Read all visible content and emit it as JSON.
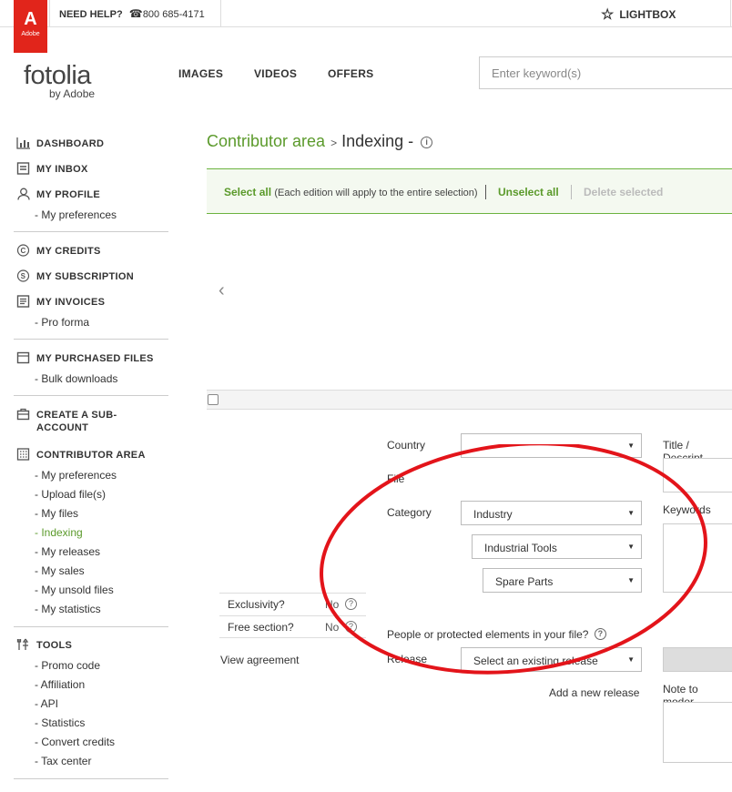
{
  "topbar": {
    "logo_text": "Adobe",
    "help_label": "NEED HELP?",
    "phone": "800 685-4171",
    "lightbox": "LIGHTBOX"
  },
  "header": {
    "brand": "fotolia",
    "brand_sub": "by Adobe",
    "nav": [
      "IMAGES",
      "VIDEOS",
      "OFFERS"
    ],
    "search_placeholder": "Enter keyword(s)"
  },
  "sidebar": {
    "dashboard": "DASHBOARD",
    "inbox": "MY INBOX",
    "profile": "MY PROFILE",
    "profile_sub": [
      "- My preferences"
    ],
    "credits": "MY CREDITS",
    "subscription": "MY SUBSCRIPTION",
    "invoices": "MY INVOICES",
    "invoices_sub": [
      "- Pro forma"
    ],
    "purchased": "MY PURCHASED FILES",
    "purchased_sub": [
      "- Bulk downloads"
    ],
    "subaccount_line1": "CREATE A SUB-",
    "subaccount_line2": "ACCOUNT",
    "contributor": "CONTRIBUTOR AREA",
    "contributor_sub": [
      "- My preferences",
      "- Upload file(s)",
      "- My files",
      "- Indexing",
      "- My releases",
      "- My sales",
      "- My unsold files",
      "- My statistics"
    ],
    "tools": "TOOLS",
    "tools_sub": [
      "- Promo code",
      "- Affiliation",
      "- API",
      "- Statistics",
      "- Convert credits",
      "- Tax center"
    ]
  },
  "breadcrumb": {
    "root": "Contributor area",
    "sep": ">",
    "current": "Indexing",
    "dash": "-"
  },
  "selection_bar": {
    "select_all": "Select all",
    "note": "(Each edition will apply to the entire selection)",
    "unselect_all": "Unselect all",
    "delete_selected": "Delete selected"
  },
  "form": {
    "country_label": "Country",
    "country_value": "",
    "file_label": "File",
    "category_label": "Category",
    "category_1": "Industry",
    "category_2": "Industrial Tools",
    "category_3": "Spare Parts",
    "people_question": "People or protected elements in your file?",
    "release_label": "Release",
    "release_value": "Select an existing release",
    "add_release": "Add a new release",
    "title_label": "Title / Descript",
    "keywords_label": "Keywords",
    "note_label": "Note to moder"
  },
  "options": {
    "exclusivity_label": "Exclusivity?",
    "exclusivity_value": "No",
    "free_label": "Free section?",
    "free_value": "No",
    "view_agreement": "View agreement"
  },
  "colors": {
    "accent": "#5b9a2b",
    "adobe_red": "#e1251b",
    "annotation": "#e3141a"
  }
}
